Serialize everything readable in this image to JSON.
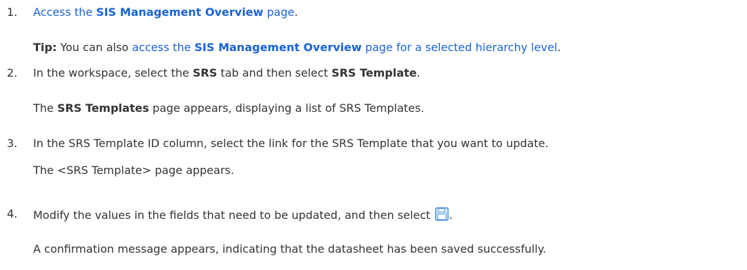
{
  "steps": [
    {
      "number": "1.",
      "link_pre": "Access the ",
      "link_bold": "SIS Management Overview",
      "link_post": " page",
      "after": ".",
      "tip": {
        "label": "Tip:",
        "text_pre": " You can also ",
        "link_pre": "access the ",
        "link_bold": "SIS Management Overview",
        "link_post": " page for a selected hierarchy level",
        "after": "."
      }
    },
    {
      "number": "2.",
      "text_a": "In the workspace, select the ",
      "bold_a": "SRS",
      "text_b": " tab and then select ",
      "bold_b": "SRS Template",
      "text_c": ".",
      "result_bold": "SRS Templates",
      "result_text": " page appears, displaying a list of SRS Templates.",
      "result_pre": "The "
    },
    {
      "number": "3.",
      "text": "In the SRS Template ID column, select the link for the SRS Template that you want to update.",
      "result": "The <SRS Template> page appears."
    },
    {
      "number": "4.",
      "text": "Modify the values in the fields that need to be updated, and then select ",
      "icon": "save-icon",
      "after": ".",
      "result": "A confirmation message appears, indicating that the datasheet has been saved successfully."
    }
  ]
}
